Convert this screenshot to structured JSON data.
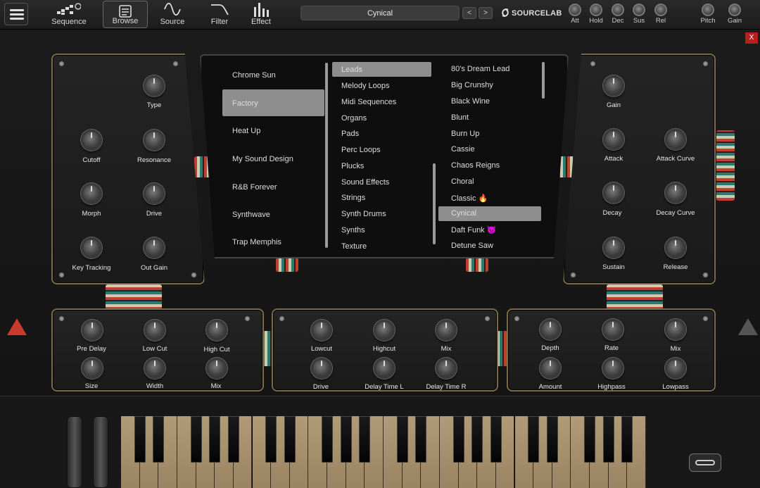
{
  "topbar": {
    "nav": [
      {
        "label": "Sequence",
        "icon": "sequence-icon"
      },
      {
        "label": "Browse",
        "icon": "browse-icon"
      },
      {
        "label": "Source",
        "icon": "source-wave-icon"
      },
      {
        "label": "Filter",
        "icon": "filter-curve-icon"
      },
      {
        "label": "Effect",
        "icon": "effect-bars-icon"
      }
    ],
    "preset_name": "Cynical",
    "prev_arrow": "<",
    "next_arrow": ">",
    "brand": "SOURCELAB",
    "envelope": [
      "Att",
      "Hold",
      "Dec",
      "Sus",
      "Rel"
    ],
    "master": [
      "Pitch",
      "Gain"
    ]
  },
  "filter_panel": {
    "knobs": [
      "Type",
      "Cutoff",
      "Resonance",
      "Morph",
      "Drive",
      "Key Tracking",
      "Out Gain"
    ]
  },
  "browser": {
    "banks": [
      "Chrome Sun",
      "Factory",
      "Heat Up",
      "My Sound Design",
      "R&B Forever",
      "Synthwave",
      "Trap Memphis"
    ],
    "selected_bank": "Factory",
    "categories": [
      "Leads",
      "Melody Loops",
      "Midi Sequences",
      "Organs",
      "Pads",
      "Perc Loops",
      "Plucks",
      "Sound Effects",
      "Strings",
      "Synth Drums",
      "Synths",
      "Texture"
    ],
    "selected_category": "Leads",
    "presets": [
      "80's Dream Lead",
      "Big Crunshy",
      "Black Wine",
      "Blunt",
      "Burn Up",
      "Cassie",
      "Chaos Reigns",
      "Choral",
      "Classic 🔥",
      "Cynical",
      "Daft Funk 😈",
      "Detune Saw"
    ],
    "selected_preset": "Cynical"
  },
  "amp_panel": {
    "knobs": [
      "Gain",
      "Attack",
      "Attack Curve",
      "Decay",
      "Decay Curve",
      "Sustain",
      "Release"
    ]
  },
  "fx_reverb": {
    "knobs": [
      "Pre Delay",
      "Low Cut",
      "High Cut",
      "Size",
      "Width",
      "Mix"
    ]
  },
  "fx_delay": {
    "knobs": [
      "Lowcut",
      "Highcut",
      "Mix",
      "Drive",
      "Delay Time L",
      "Delay Time R"
    ]
  },
  "fx_chorus": {
    "knobs": [
      "Depth",
      "Rate",
      "Mix",
      "Amount",
      "Highpass",
      "Lowpass"
    ]
  },
  "close_label": "X",
  "colors": {
    "accent_gold": "#7a6a48",
    "highlight": "#8e8e8e",
    "warning": "#c83a2a"
  }
}
